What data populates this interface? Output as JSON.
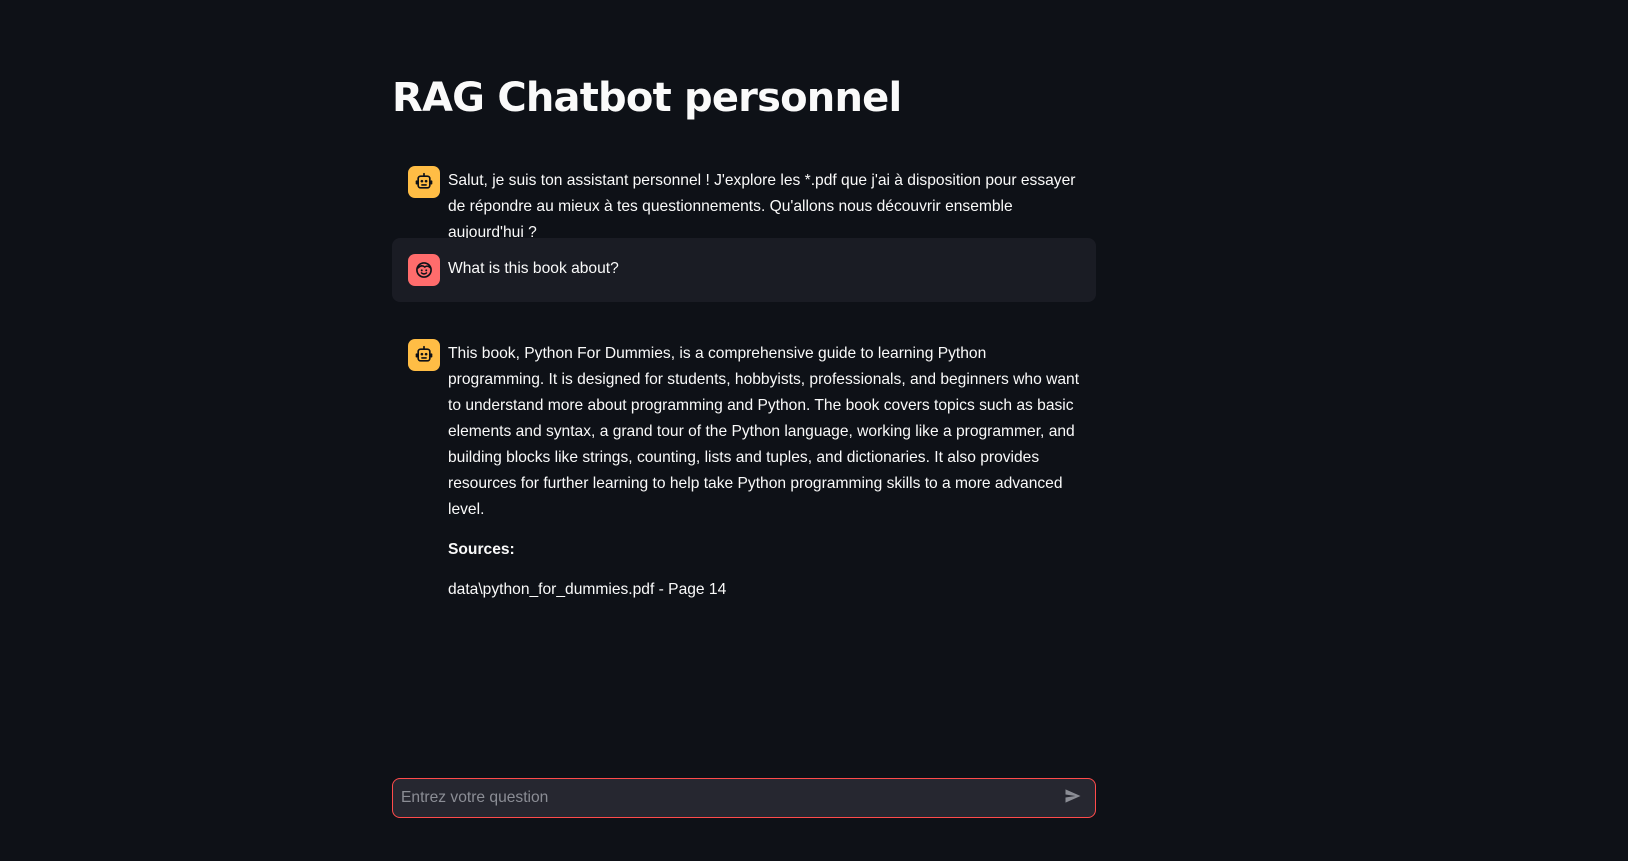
{
  "page": {
    "title": "RAG Chatbot personnel"
  },
  "messages": [
    {
      "role": "assistant",
      "avatar_icon": "robot-icon",
      "text": "Salut, je suis ton assistant personnel ! J'explore les *.pdf que j'ai à disposition pour essayer de répondre au mieux à tes questionnements. Qu'allons nous découvrir ensemble aujourd'hui ?"
    },
    {
      "role": "user",
      "avatar_icon": "smiley-icon",
      "text": "What is this book about?"
    },
    {
      "role": "assistant",
      "avatar_icon": "robot-icon",
      "text": "This book, Python For Dummies, is a comprehensive guide to learning Python programming. It is designed for students, hobbyists, professionals, and beginners who want to understand more about programming and Python. The book covers topics such as basic elements and syntax, a grand tour of the Python language, working like a programmer, and building blocks like strings, counting, lists and tuples, and dictionaries. It also provides resources for further learning to help take Python programming skills to a more advanced level.",
      "sources_label": "Sources:",
      "source": "data\\python_for_dummies.pdf - Page 14"
    }
  ],
  "chat_input": {
    "placeholder": "Entrez votre question",
    "value": "",
    "send_icon": "send-icon"
  },
  "colors": {
    "background": "#0e1117",
    "user_message_bg": "#1a1c24",
    "assistant_avatar": "#ffbd45",
    "user_avatar": "#ff6c6c",
    "input_border": "#ff4b4b",
    "input_bg": "#262730"
  }
}
